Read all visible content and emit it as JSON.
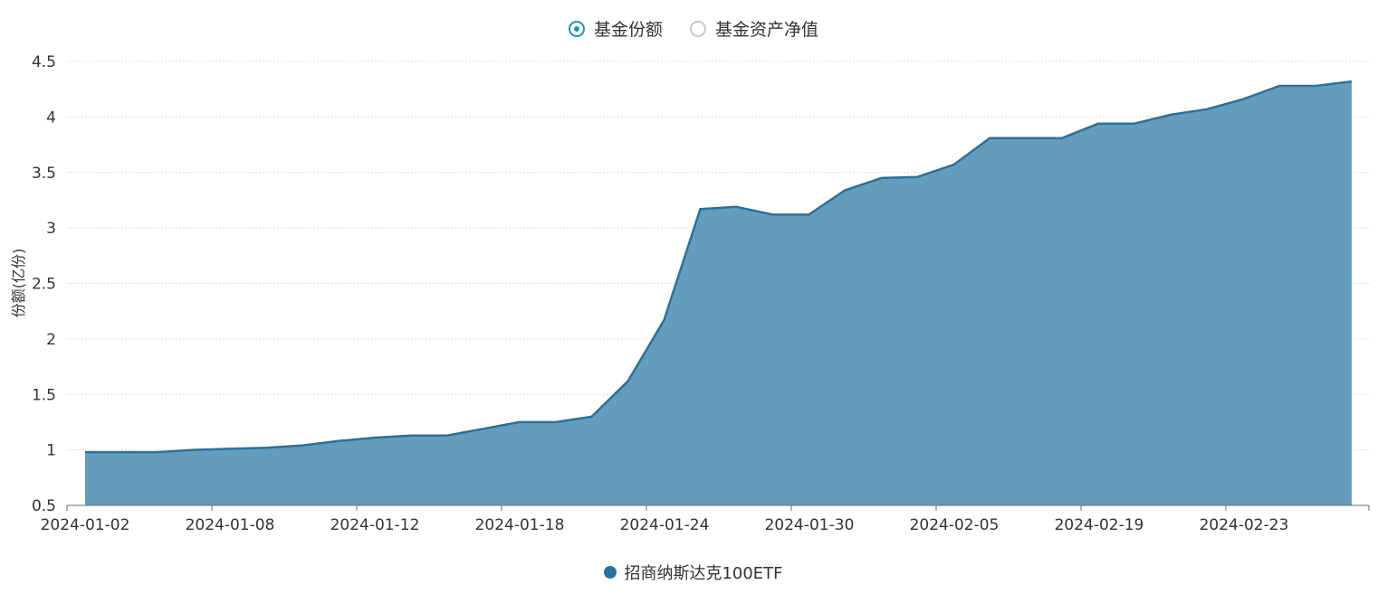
{
  "toggles": [
    {
      "label": "基金份额",
      "checked": true
    },
    {
      "label": "基金资产净值",
      "checked": false
    }
  ],
  "colors": {
    "line": "#2672a0",
    "fill": "#4f8fb3",
    "accent": "#1a98a8"
  },
  "chart_data": {
    "type": "area",
    "ylabel": "份额(亿份)",
    "ylim": [
      0.5,
      4.5
    ],
    "yticks": [
      "0.5",
      "1",
      "1.5",
      "2",
      "2.5",
      "3",
      "3.5",
      "4",
      "4.5"
    ],
    "xticks": [
      "2024-01-02",
      "2024-01-08",
      "2024-01-12",
      "2024-01-18",
      "2024-01-24",
      "2024-01-30",
      "2024-02-05",
      "2024-02-19",
      "2024-02-23"
    ],
    "grid": true,
    "legend_position": "bottom",
    "series": [
      {
        "name": "招商纳斯达克100ETF",
        "values": [
          0.98,
          0.98,
          0.98,
          1.0,
          1.01,
          1.02,
          1.04,
          1.08,
          1.11,
          1.13,
          1.13,
          1.19,
          1.25,
          1.25,
          1.3,
          1.62,
          2.17,
          3.17,
          3.19,
          3.12,
          3.12,
          3.34,
          3.45,
          3.46,
          3.57,
          3.81,
          3.81,
          3.81,
          3.94,
          3.94,
          4.02,
          4.07,
          4.16,
          4.28,
          4.28,
          4.32
        ]
      }
    ]
  }
}
